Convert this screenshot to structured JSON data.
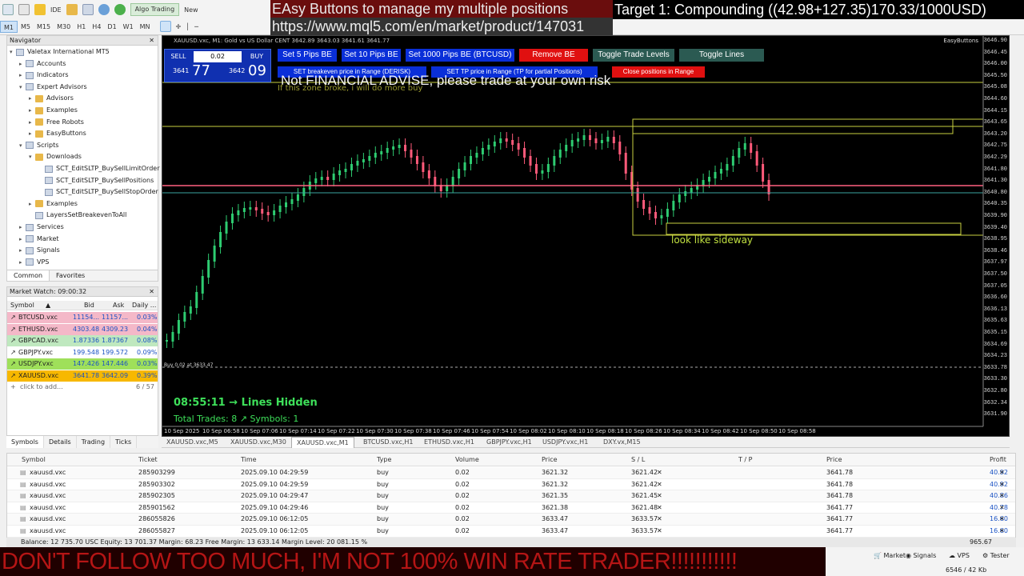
{
  "toolbar": {
    "ide_label": "IDE",
    "algo_label": "Algo Trading",
    "new_label": "New",
    "timeframes": [
      "M1",
      "M5",
      "M15",
      "M30",
      "H1",
      "H4",
      "D1",
      "W1",
      "MN"
    ],
    "active_timeframe": "M1"
  },
  "overlays": {
    "title": "EAsy Buttons to manage my multiple positions",
    "url": "https://www.mql5.com/en/market/product/147031",
    "target": "Target 1: Compounding ((42.98+127.35)170.33/1000USD)",
    "disclaimer": "Not FINANCIAL ADVISE, please trade at your own risk",
    "bottom": "DON'T FOLLOW TOO MUCH, I'M NOT 100% WIN RATE TRADER!!!!!!!!!!!"
  },
  "navigator": {
    "title": "Navigator",
    "items": [
      {
        "label": "Valetax International MT5",
        "level": 0,
        "icon": "terminal-icon",
        "expanded": true
      },
      {
        "label": "Accounts",
        "level": 1,
        "icon": "accounts-icon"
      },
      {
        "label": "Indicators",
        "level": 1,
        "icon": "indicators-icon"
      },
      {
        "label": "Expert Advisors",
        "level": 1,
        "icon": "experts-icon",
        "expanded": true
      },
      {
        "label": "Advisors",
        "level": 2,
        "icon": "folder-icon"
      },
      {
        "label": "Examples",
        "level": 2,
        "icon": "folder-icon"
      },
      {
        "label": "Free Robots",
        "level": 2,
        "icon": "folder-icon"
      },
      {
        "label": "EasyButtons",
        "level": 2,
        "icon": "folder-icon"
      },
      {
        "label": "Scripts",
        "level": 1,
        "icon": "scripts-icon",
        "expanded": true
      },
      {
        "label": "Downloads",
        "level": 2,
        "icon": "folder-icon",
        "expanded": true
      },
      {
        "label": "SCT_EditSLTP_BuySellLimitOrder",
        "level": 3,
        "icon": "script-file-icon"
      },
      {
        "label": "SCT_EditSLTP_BuySellPositions",
        "level": 3,
        "icon": "script-file-icon"
      },
      {
        "label": "SCT_EditSLTP_BuySellStopOrder",
        "level": 3,
        "icon": "script-file-icon"
      },
      {
        "label": "Examples",
        "level": 2,
        "icon": "folder-icon"
      },
      {
        "label": "LayersSetBreakevenToAll",
        "level": 2,
        "icon": "script-file-icon"
      },
      {
        "label": "Services",
        "level": 1,
        "icon": "services-icon"
      },
      {
        "label": "Market",
        "level": 1,
        "icon": "market-icon"
      },
      {
        "label": "Signals",
        "level": 1,
        "icon": "signals-icon"
      },
      {
        "label": "VPS",
        "level": 1,
        "icon": "vps-icon"
      }
    ],
    "tabs": [
      "Common",
      "Favorites"
    ]
  },
  "market_watch": {
    "title": "Market Watch: 09:00:32",
    "columns": [
      "Symbol",
      "Bid",
      "Ask",
      "Daily ..."
    ],
    "rows": [
      {
        "symbol": "BTCUSD.vxc",
        "bid": "11154...",
        "ask": "11157...",
        "daily": "0.03%",
        "bg": "#f4b8c8"
      },
      {
        "symbol": "ETHUSD.vxc",
        "bid": "4303.48",
        "ask": "4309.23",
        "daily": "0.04%",
        "bg": "#f4b8c8"
      },
      {
        "symbol": "GBPCAD.vxc",
        "bid": "1.87336",
        "ask": "1.87367",
        "daily": "0.08%",
        "bg": "#bfe8bf"
      },
      {
        "symbol": "GBPJPY.vxc",
        "bid": "199.548",
        "ask": "199.572",
        "daily": "0.09%",
        "bg": "#ffffff"
      },
      {
        "symbol": "USDJPY.vxc",
        "bid": "147.426",
        "ask": "147.446",
        "daily": "0.03%",
        "bg": "#9fe05a"
      },
      {
        "symbol": "XAUUSD.vxc",
        "bid": "3641.78",
        "ask": "3642.09",
        "daily": "0.39%",
        "bg": "#f7b800"
      }
    ],
    "add_label": "click to add...",
    "count": "6 / 57",
    "tabs": [
      "Symbols",
      "Details",
      "Trading",
      "Ticks"
    ]
  },
  "chart": {
    "header": "XAUUSD.vxc, M1: Gold vs US Dollar CENT  3642.89 3643.03 3641.61 3641.77",
    "ea_label": "EasyButtons",
    "sell_label": "SELL",
    "buy_label": "BUY",
    "lot": "0.02",
    "sell_price_small": "3641",
    "sell_price_big": "77",
    "buy_price_small": "3642",
    "buy_price_big": "09",
    "buttons": {
      "be5": "Set 5 Pips BE",
      "be10": "Set 10 Pips BE",
      "be1000": "Set 1000 Pips BE (BTCUSD)",
      "remove_be": "Remove BE",
      "toggle_levels": "Toggle Trade Levels",
      "toggle_lines": "Toggle Lines",
      "set_be_range": "SET breakeven price in Range (DERISK)",
      "set_tp_range": "SET TP price in Range (TP for partial Positions)",
      "close_range": "Close positions in Range"
    },
    "zone_note": "If this zone broke, i will do more buy",
    "sideway_note": "look like sideway",
    "lines_hidden": "08:55:11 → Lines Hidden",
    "total_trades": "Total Trades: 8 ↗ Symbols: 1",
    "buy_line_label": "Buy 0.02 at 3633.47",
    "price_scale": [
      "3646.90",
      "3646.45",
      "3646.00",
      "3645.50",
      "3645.08",
      "3644.60",
      "3644.15",
      "3643.65",
      "3643.20",
      "3642.75",
      "3642.29",
      "3641.80",
      "3641.30",
      "3640.80",
      "3640.35",
      "3639.90",
      "3639.40",
      "3638.95",
      "3638.46",
      "3637.97",
      "3637.50",
      "3637.05",
      "3636.60",
      "3636.13",
      "3635.63",
      "3635.15",
      "3634.69",
      "3634.23",
      "3633.78",
      "3633.30",
      "3632.80",
      "3632.34",
      "3631.90"
    ],
    "time_labels": [
      "10 Sep 2025",
      "10 Sep 06:58",
      "10 Sep 07:06",
      "10 Sep 07:14",
      "10 Sep 07:22",
      "10 Sep 07:30",
      "10 Sep 07:38",
      "10 Sep 07:46",
      "10 Sep 07:54",
      "10 Sep 08:02",
      "10 Sep 08:10",
      "10 Sep 08:18",
      "10 Sep 08:26",
      "10 Sep 08:34",
      "10 Sep 08:42",
      "10 Sep 08:50",
      "10 Sep 08:58"
    ]
  },
  "chart_tabs": [
    "XAUUSD.vxc,M5",
    "XAUUSD.vxc,M30",
    "XAUUSD.vxc,M1",
    "BTCUSD.vxc,H1",
    "ETHUSD.vxc,H1",
    "GBPJPY.vxc,H1",
    "USDJPY.vxc,H1",
    "DXY.vx,M15"
  ],
  "active_chart_tab": 2,
  "trade": {
    "columns": [
      "Symbol",
      "Ticket",
      "Time",
      "Type",
      "Volume",
      "Price",
      "S / L",
      "T / P",
      "Price",
      "Profit"
    ],
    "rows": [
      {
        "symbol": "xauusd.vxc",
        "ticket": "285903299",
        "time": "2025.09.10 04:29:59",
        "type": "buy",
        "volume": "0.02",
        "price": "3621.32",
        "sl": "3621.42",
        "tp": "",
        "cur": "3641.78",
        "profit": "40.92"
      },
      {
        "symbol": "xauusd.vxc",
        "ticket": "285903302",
        "time": "2025.09.10 04:29:59",
        "type": "buy",
        "volume": "0.02",
        "price": "3621.32",
        "sl": "3621.42",
        "tp": "",
        "cur": "3641.78",
        "profit": "40.92"
      },
      {
        "symbol": "xauusd.vxc",
        "ticket": "285902305",
        "time": "2025.09.10 04:29:47",
        "type": "buy",
        "volume": "0.02",
        "price": "3621.35",
        "sl": "3621.45",
        "tp": "",
        "cur": "3641.78",
        "profit": "40.86"
      },
      {
        "symbol": "xauusd.vxc",
        "ticket": "285901562",
        "time": "2025.09.10 04:29:46",
        "type": "buy",
        "volume": "0.02",
        "price": "3621.38",
        "sl": "3621.48",
        "tp": "",
        "cur": "3641.77",
        "profit": "40.78"
      },
      {
        "symbol": "xauusd.vxc",
        "ticket": "286055826",
        "time": "2025.09.10 06:12:05",
        "type": "buy",
        "volume": "0.02",
        "price": "3633.47",
        "sl": "3633.57",
        "tp": "",
        "cur": "3641.77",
        "profit": "16.60"
      },
      {
        "symbol": "xauusd.vxc",
        "ticket": "286055827",
        "time": "2025.09.10 06:12:05",
        "type": "buy",
        "volume": "0.02",
        "price": "3633.47",
        "sl": "3633.57",
        "tp": "",
        "cur": "3641.77",
        "profit": "16.60"
      }
    ],
    "balance_line": "Balance: 12 735.70 USC  Equity: 13 701.37  Margin: 68.23  Free Margin: 13 633.14  Margin Level: 20 081.15 %",
    "total_profit": "965.67"
  },
  "status": {
    "market": "Market",
    "signals": "Signals",
    "vps": "VPS",
    "tester": "Tester",
    "traffic": "6546 / 42 Kb"
  }
}
